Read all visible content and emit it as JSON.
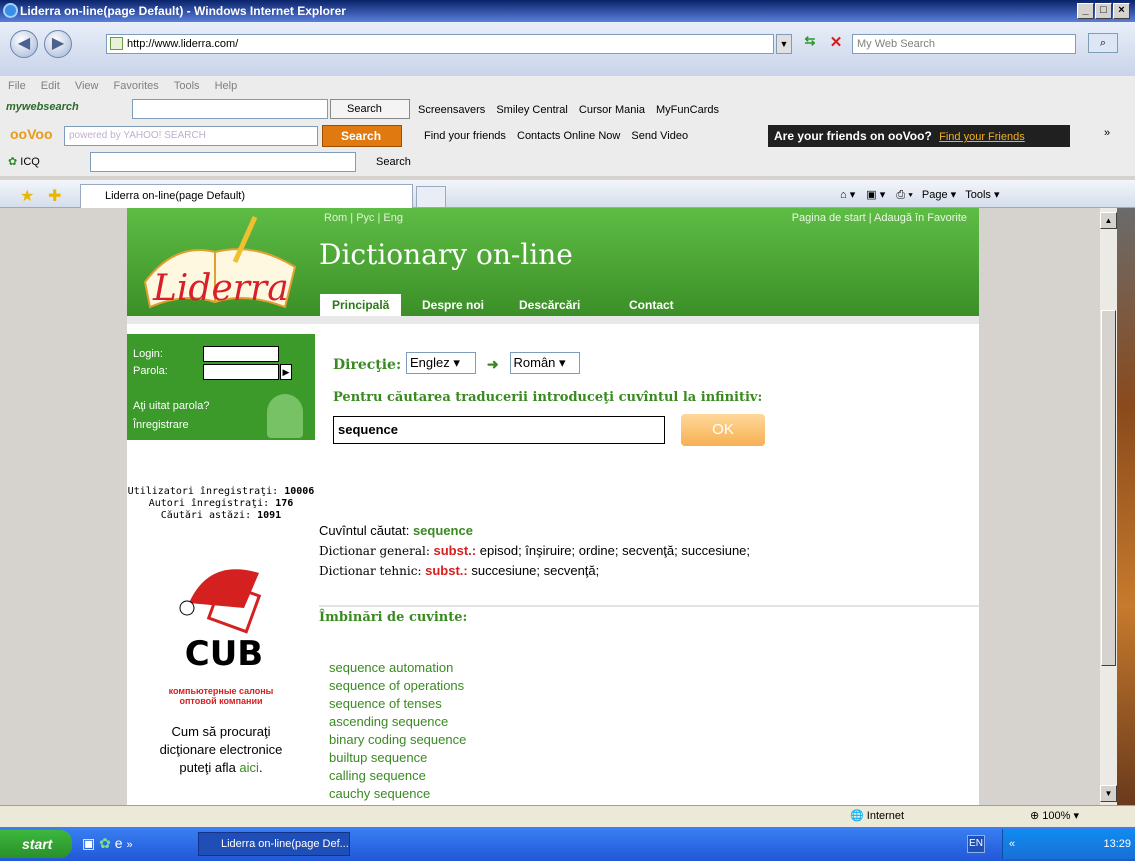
{
  "window": {
    "title": "Liderra on-line(page Default) - Windows Internet Explorer",
    "min": "_",
    "max": "□",
    "close": "×"
  },
  "address": {
    "url": "http://www.liderra.com/",
    "search_placeholder": "My Web Search"
  },
  "menu": [
    "File",
    "Edit",
    "View",
    "Favorites",
    "Tools",
    "Help"
  ],
  "toolbar_mws": {
    "brand": "mywebsearch",
    "search_label": "Search",
    "items": [
      "Screensavers",
      "Smiley Central",
      "Cursor Mania",
      "MyFunCards"
    ]
  },
  "toolbar_oovoo": {
    "brand": "ooVoo",
    "yahoo": "powered by YAHOO! SEARCH",
    "search_label": "Search",
    "items": [
      "Find your friends",
      "Contacts Online Now",
      "Send Video"
    ],
    "promo": "Are your friends on ooVoo?",
    "promo_link": "Find your Friends",
    "more": "»"
  },
  "toolbar_icq": {
    "brand": "ICQ",
    "search_label": "Search"
  },
  "tabbar": {
    "tab_title": "Liderra on-line(page Default)",
    "page_label": "Page",
    "tools_label": "Tools"
  },
  "site": {
    "logo_text": "Liderra",
    "langs": "Rom | Рус | Eng",
    "start_links": "Pagina de start | Adaugă în Favorite",
    "title": "Dictionary on-line",
    "nav": [
      "Principală",
      "Despre noi",
      "Descărcări",
      "Contact"
    ],
    "login_label": "Login:",
    "password_label": "Parola:",
    "forgot": "Aţi uitat parola?",
    "register": "Înregistrare",
    "stats": [
      {
        "label": "Utilizatori înregistraţi:",
        "value": "10006"
      },
      {
        "label": "Autori înregistraţi:",
        "value": "176"
      },
      {
        "label": "Căutări astăzi:",
        "value": "1091"
      }
    ],
    "cub_brand": "CUB",
    "cub_sub1": "компьютерные салоны",
    "cub_sub2": "оптовой компании",
    "buy_text1": "Cum să procuraţi",
    "buy_text2": "dicţionare electronice",
    "buy_text3": "puteţi afla",
    "buy_link": "aici",
    "direction_label": "Direcţie:",
    "lang_from": "Englez",
    "lang_to": "Român",
    "instruction": "Pentru căutarea traducerii introduceţi cuvîntul la infinitiv:",
    "search_value": "sequence",
    "ok_label": "OK",
    "searched_label": "Cuvîntul căutat:",
    "searched_word": "sequence",
    "general_label": "Dictionar general:",
    "general_pos": "subst.:",
    "general_trans": "episod; înşiruire; ordine; secvenţă; succesiune;",
    "tech_label": "Dictionar tehnic:",
    "tech_pos": "subst.:",
    "tech_trans": "succesiune; secvenţă;",
    "combos_title": "Îmbinări de cuvinte:",
    "phrases": [
      "sequence automation",
      "sequence of operations",
      "sequence of tenses",
      "ascending sequence",
      "binary coding sequence",
      "builtup sequence",
      "calling sequence",
      "cauchy sequence"
    ]
  },
  "statusbar": {
    "zone": "Internet",
    "zoom": "100%"
  },
  "taskbar": {
    "start": "start",
    "more": "»",
    "item": "Liderra on-line(page Def...",
    "lang": "EN",
    "tray_more": "«",
    "time": "13:29"
  }
}
